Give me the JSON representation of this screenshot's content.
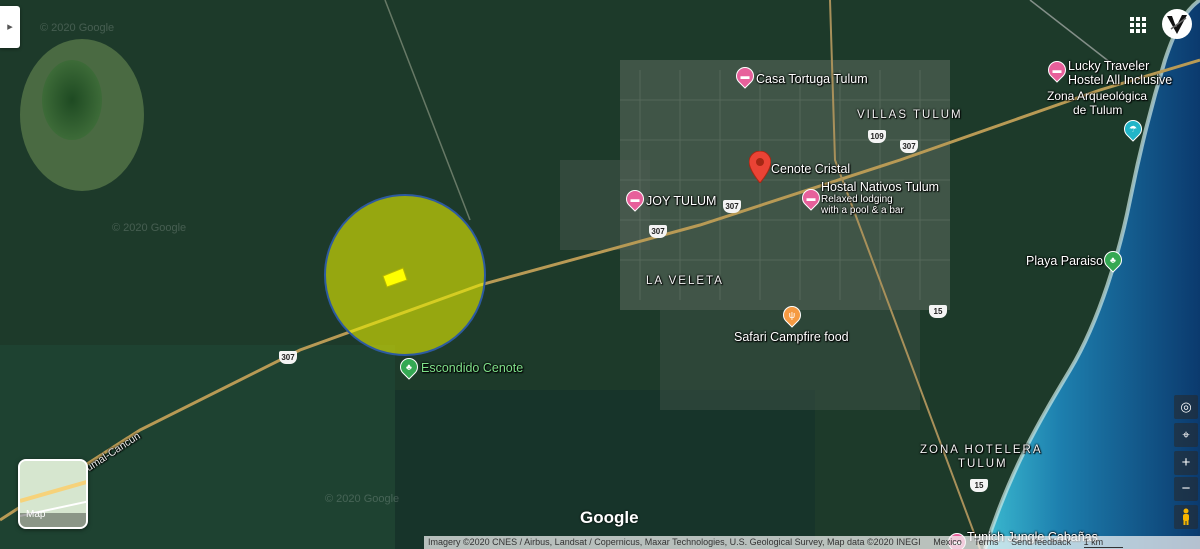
{
  "colors": {
    "accent": "#ea4335",
    "poi_pink": "#e7609b",
    "park_green": "#34a853",
    "food_orange": "#f59a42",
    "beach_blue": "#22b5c8",
    "radius_yellow": "#e8f000",
    "radius_border": "#2d5aa0"
  },
  "map": {
    "places": [
      {
        "name": "Casa Tortuga Tulum",
        "icon": "hotel-icon"
      },
      {
        "name": "Lucky Traveler",
        "icon": "hotel-icon"
      },
      {
        "name": "Hostel All Inclusive",
        "icon": ""
      },
      {
        "name": "Cenote Cristal",
        "icon": "location-pin-icon"
      },
      {
        "name": "Hostal Nativos Tulum",
        "icon": "hotel-icon"
      },
      {
        "name": "Relaxed lodging",
        "icon": ""
      },
      {
        "name": "with a pool & a bar",
        "icon": ""
      },
      {
        "name": "JOY TULUM",
        "icon": "hotel-icon"
      },
      {
        "name": "Safari Campfire food",
        "icon": "restaurant-icon"
      },
      {
        "name": "Escondido Cenote",
        "icon": "park-icon"
      },
      {
        "name": "Playa Paraiso",
        "icon": "park-icon"
      },
      {
        "name": "Tunich Jungle Cabañas",
        "icon": "hotel-icon"
      }
    ],
    "areas": [
      "VILLAS TULUM",
      "LA VELETA",
      "ZONA HOTELERA",
      "TULUM"
    ],
    "landmark": [
      "Zona Arqueológica",
      "de Tulum"
    ],
    "roads": [
      "307",
      "307",
      "307",
      "109",
      "307",
      "15",
      "15"
    ],
    "road_name": "umal-Cancun",
    "watermarks": [
      "© 2020 Google",
      "© 2020 Google",
      "© 2020 Google"
    ]
  },
  "controls": {
    "sidebar_toggle": "▸",
    "apps_icon": "apps-grid-icon",
    "minimap_label": "Map",
    "google_logo": "Google",
    "zoom_in": "+",
    "zoom_out": "−",
    "globe_icon": "globe-icon",
    "locate_icon": "my-location-icon",
    "pegman_icon": "street-view-pegman-icon"
  },
  "footer": {
    "imagery": "Imagery ©2020 CNES / Airbus, Landsat / Copernicus, Maxar Technologies, U.S. Geological Survey, Map data ©2020 INEGI",
    "region": "Mexico",
    "terms": "Terms",
    "feedback": "Send feedback",
    "scale": "1 km"
  }
}
